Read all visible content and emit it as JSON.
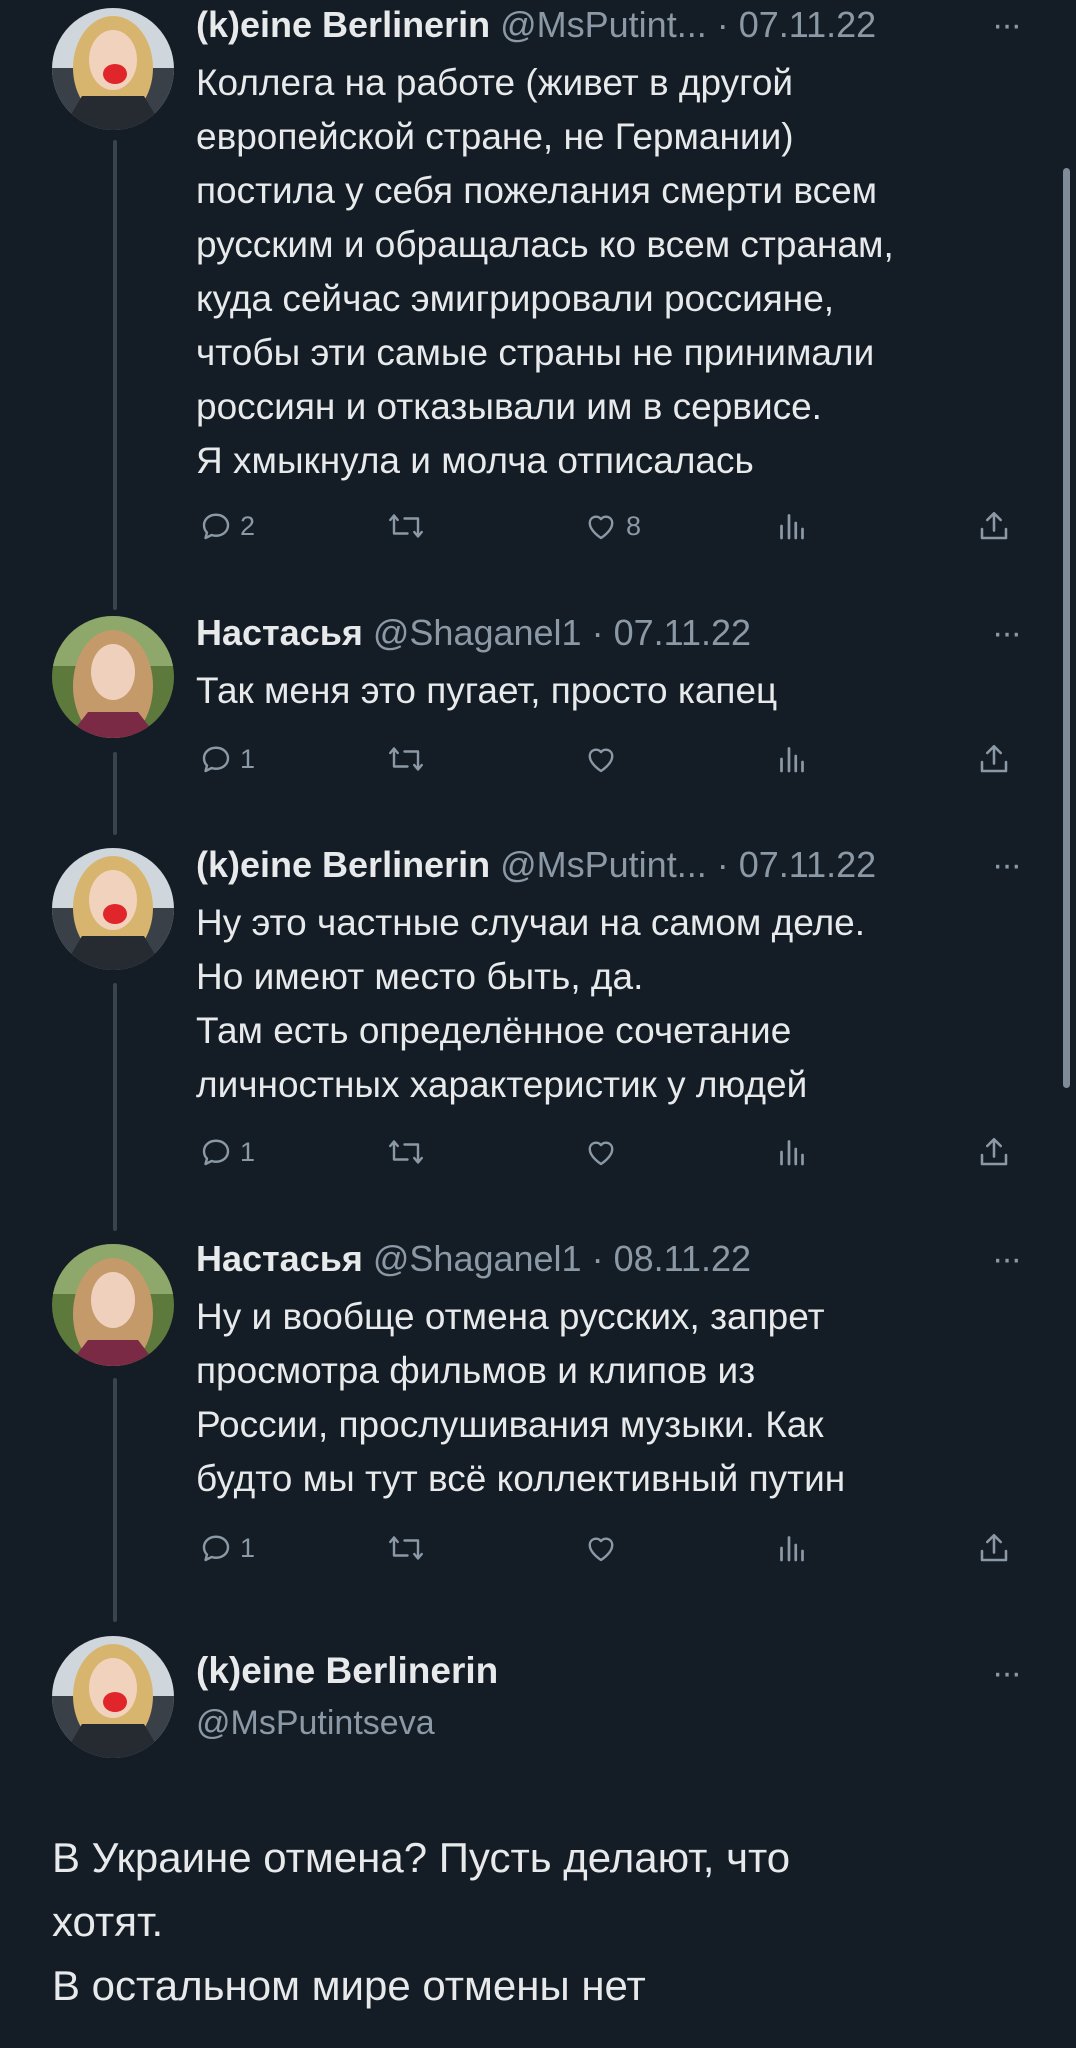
{
  "tweets": [
    {
      "name": "(k)eine Berlinerin",
      "handle": "@MsPutint...",
      "date": "07.11.22",
      "lines": [
        "Коллега на работе (живет в другой",
        "европейской стране, не Германии)",
        "постила у себя пожелания смерти всем",
        "русским и обращалась ко всем странам,",
        "куда сейчас эмигрировали россияне,",
        "чтобы эти самые страны не принимали",
        "россиян и отказывали им в сервисе.",
        "Я хмыкнула и молча отписалась"
      ],
      "replies": "2",
      "retweets": "",
      "likes": "8"
    },
    {
      "name": "Настасья",
      "handle": "@Shaganel1",
      "date": "07.11.22",
      "lines": [
        "Так меня это пугает, просто капец"
      ],
      "replies": "1",
      "retweets": "",
      "likes": ""
    },
    {
      "name": "(k)eine Berlinerin",
      "handle": "@MsPutint...",
      "date": "07.11.22",
      "lines": [
        "Ну это частные случаи на самом деле.",
        "Но имеют место быть, да.",
        "Там есть определённое сочетание",
        "личностных характеристик у людей"
      ],
      "replies": "1",
      "retweets": "",
      "likes": ""
    },
    {
      "name": "Настасья",
      "handle": "@Shaganel1",
      "date": "08.11.22",
      "lines": [
        "Ну и вообще отмена русских, запрет",
        "просмотра фильмов и клипов из",
        "России, прослушивания музыки. Как",
        "будто мы тут всё коллективный путин"
      ],
      "replies": "1",
      "retweets": "",
      "likes": ""
    }
  ],
  "main_tweet": {
    "name": "(k)eine Berlinerin",
    "handle": "@MsPutintseva",
    "lines": [
      "В Украине отмена? Пусть делают, что",
      "хотят.",
      "В остальном мире отмены нет"
    ]
  },
  "separator": " · ",
  "more_glyph": "···",
  "colors": {
    "background": "#141d26",
    "text": "#e7e9ea",
    "muted": "#8b98a5",
    "line": "#38444d"
  }
}
